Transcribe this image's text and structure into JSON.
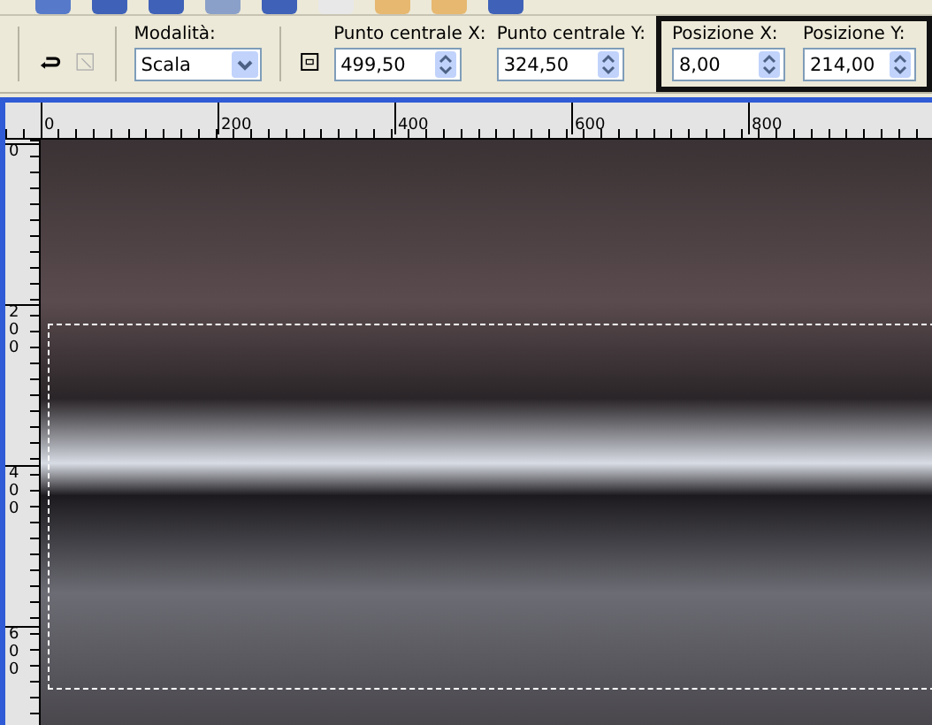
{
  "toolbar": {
    "mode": {
      "label": "Modalità:",
      "value": "Scala"
    },
    "fields": [
      {
        "label": "Punto centrale X:",
        "value": "499,50"
      },
      {
        "label": "Punto centrale Y:",
        "value": "324,50"
      }
    ],
    "highlighted_fields": [
      {
        "label": "Posizione X:",
        "value": "8,00"
      },
      {
        "label": "Posizione Y:",
        "value": "214,00"
      }
    ]
  },
  "rulers": {
    "horizontal": [
      "0",
      "200",
      "400",
      "600",
      "800"
    ],
    "vertical": [
      "0",
      "200",
      "400",
      "600"
    ]
  }
}
